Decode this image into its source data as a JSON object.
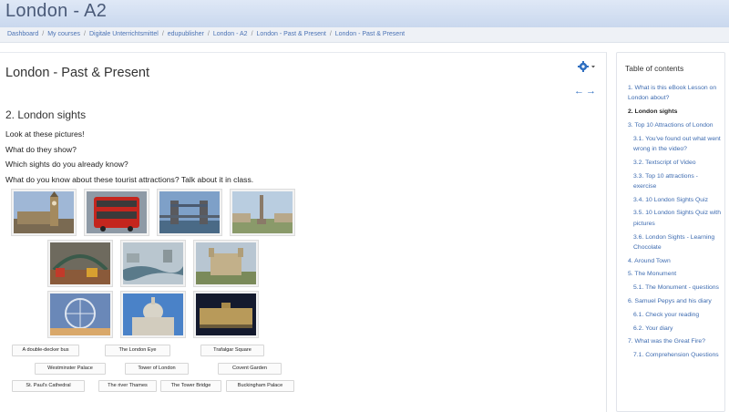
{
  "header": {
    "site_title": "London - A2"
  },
  "breadcrumb": {
    "items": [
      "Dashboard",
      "My courses",
      "Digitale Unterrichtsmittel",
      "edupublisher",
      "London - A2",
      "London - Past & Present",
      "London - Past & Present"
    ]
  },
  "main": {
    "page_title": "London - Past & Present",
    "nav_arrows": "←→",
    "section_title": "2. London sights",
    "intro_lines": [
      "Look at these pictures!",
      "What do they show?",
      "Which sights do you already know?",
      "What do you know about these tourist attractions? Talk about it in class."
    ],
    "photos": [
      "big-ben",
      "double-decker-bus",
      "tower-bridge",
      "trafalgar-square",
      "covent-garden",
      "river-thames",
      "tower-of-london",
      "london-eye",
      "st-pauls-cathedral",
      "buckingham-palace"
    ],
    "tags": [
      "A double-decker bus",
      "The London Eye",
      "Trafalgar Square",
      "Westminster Palace",
      "Tower of London",
      "Covent Garden",
      "St. Paul's Cathedral",
      "The river Thames",
      "The Tower Bridge",
      "Buckingham Palace"
    ]
  },
  "toc": {
    "title": "Table of contents",
    "items": [
      {
        "label": "1. What is this eBook Lesson on London about?",
        "level": 1,
        "active": false
      },
      {
        "label": "2. London sights",
        "level": 1,
        "active": true
      },
      {
        "label": "3. Top 10 Attractions of London",
        "level": 1,
        "active": false
      },
      {
        "label": "3.1. You've found out what went wrong in the video?",
        "level": 2,
        "active": false
      },
      {
        "label": "3.2. Textscript of Video",
        "level": 2,
        "active": false
      },
      {
        "label": "3.3. Top 10 attractions - exercise",
        "level": 2,
        "active": false
      },
      {
        "label": "3.4. 10 London Sights Quiz",
        "level": 2,
        "active": false
      },
      {
        "label": "3.5. 10 London Sights Quiz with pictures",
        "level": 2,
        "active": false
      },
      {
        "label": "3.6. London Sights - Learning Chocolate",
        "level": 2,
        "active": false
      },
      {
        "label": "4. Around Town",
        "level": 1,
        "active": false
      },
      {
        "label": "5. The Monument",
        "level": 1,
        "active": false
      },
      {
        "label": "5.1. The Monument - questions",
        "level": 2,
        "active": false
      },
      {
        "label": "6. Samuel Pepys and his diary",
        "level": 1,
        "active": false
      },
      {
        "label": "6.1. Check your reading",
        "level": 2,
        "active": false
      },
      {
        "label": "6.2. Your diary",
        "level": 2,
        "active": false
      },
      {
        "label": "7. What was the Great Fire?",
        "level": 1,
        "active": false
      },
      {
        "label": "7.1. Comprehension Questions",
        "level": 2,
        "active": false
      }
    ]
  },
  "colors": {
    "link": "#3d6bb0",
    "header_bg": "#c9d8ee",
    "accent": "#2f6fc0"
  }
}
